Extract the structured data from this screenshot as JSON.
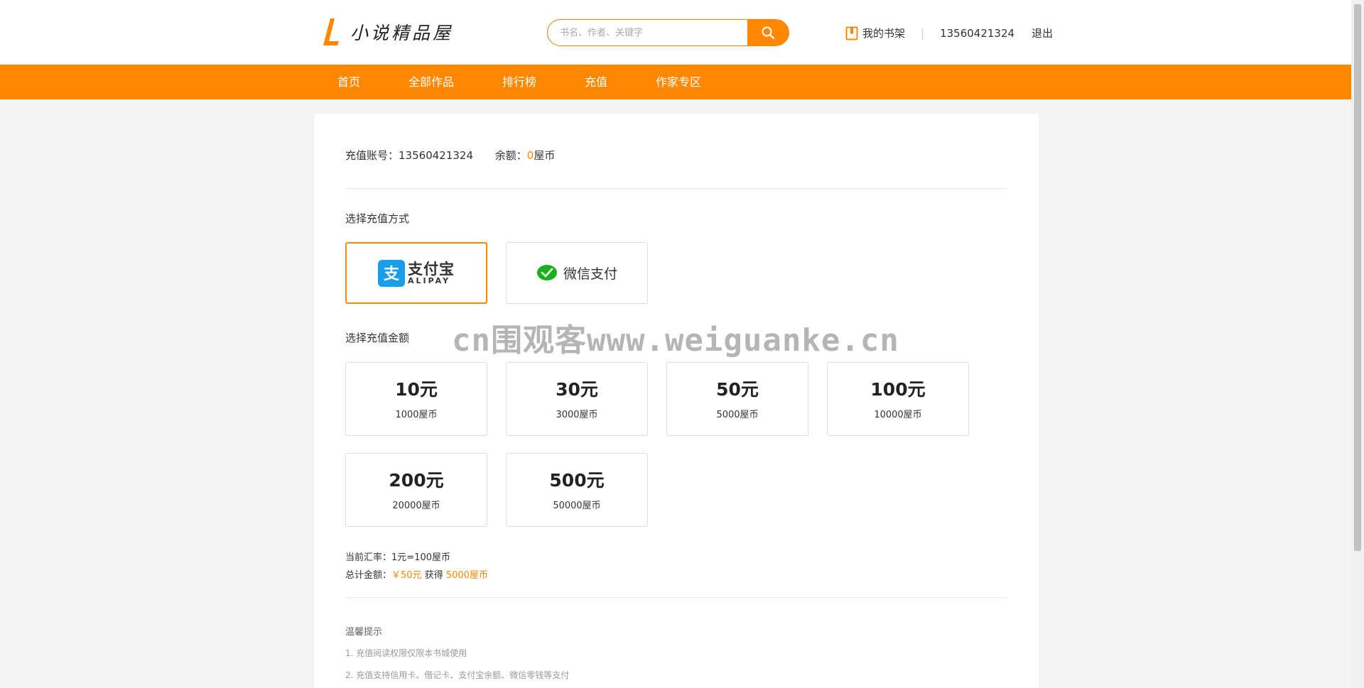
{
  "header": {
    "logo_text": "小说精品屋",
    "search_placeholder": "书名、作者、关键字",
    "bookshelf_label": "我的书架",
    "separator": "|",
    "username": "13560421324",
    "logout_label": "退出"
  },
  "nav": {
    "items": [
      "首页",
      "全部作品",
      "排行榜",
      "充值",
      "作家专区"
    ]
  },
  "account": {
    "account_label": "充值账号：",
    "account_value": "13560421324",
    "balance_label": "余额：",
    "balance_value": "0",
    "balance_unit": "屋币"
  },
  "payment": {
    "title": "选择充值方式",
    "alipay_cn": "支付宝",
    "alipay_en": "ALIPAY",
    "wechat_label": "微信支付",
    "selected": "alipay"
  },
  "amounts": {
    "title": "选择充值金额",
    "options": [
      {
        "yuan": "10元",
        "coins": "1000屋币"
      },
      {
        "yuan": "30元",
        "coins": "3000屋币"
      },
      {
        "yuan": "50元",
        "coins": "5000屋币"
      },
      {
        "yuan": "100元",
        "coins": "10000屋币"
      },
      {
        "yuan": "200元",
        "coins": "20000屋币"
      },
      {
        "yuan": "500元",
        "coins": "50000屋币"
      }
    ]
  },
  "summary": {
    "rate_label": "当前汇率：",
    "rate_value": "1元=100屋币",
    "total_label": "总计金额：",
    "total_amount": "￥50元",
    "get_label": "获得",
    "total_coins": "5000屋币"
  },
  "tips": {
    "title": "温馨提示",
    "items": [
      "1. 充值阅读权限仅限本书城使用",
      "2. 充值支持信用卡、借记卡、支付宝余额、微信零钱等支付"
    ]
  },
  "watermark": "cn围观客www.weiguanke.cn",
  "colors": {
    "accent": "#ff8800",
    "alipay_blue": "#1a9ee8",
    "wechat_green": "#19b01b"
  }
}
